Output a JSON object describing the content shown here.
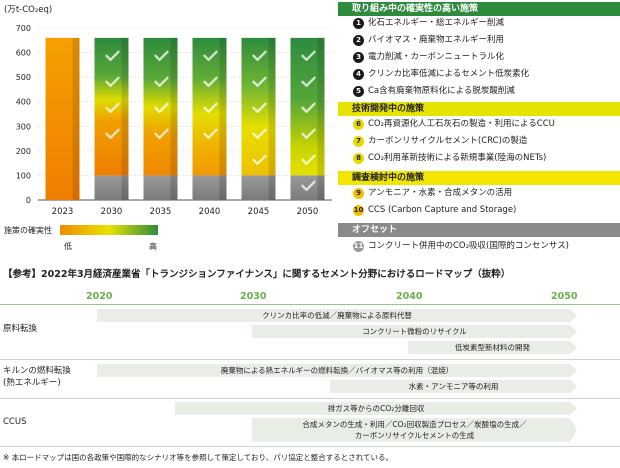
{
  "chart_data": {
    "type": "bar",
    "ylabel": "(万t-CO₂eq)",
    "ylim": [
      0,
      700
    ],
    "yticks": [
      0,
      100,
      200,
      300,
      400,
      500,
      600,
      700
    ],
    "categories": [
      "2023",
      "2030",
      "2035",
      "2040",
      "2045",
      "2050"
    ],
    "values": [
      660,
      660,
      660,
      660,
      660,
      660
    ],
    "offset_values": [
      0,
      100,
      100,
      100,
      100,
      100
    ],
    "check_marks": [
      0,
      4,
      4,
      4,
      5,
      6
    ],
    "legend": {
      "title": "施策の確実性",
      "low": "低",
      "high": "高"
    },
    "colors": {
      "high": "#2e8b3e",
      "mid": "#e6e300",
      "low": "#f08c00",
      "offset": "#8a8a8a"
    }
  },
  "sections": {
    "high": {
      "title": "取り組み中の確実性の高い施策",
      "items": [
        {
          "n": "1",
          "text": "化石エネルギー・総エネルギー削減"
        },
        {
          "n": "2",
          "text": "バイオマス・廃棄物エネルギー利用"
        },
        {
          "n": "3",
          "text": "電力削減・カーボンニュートラル化"
        },
        {
          "n": "4",
          "text": "クリンカ比率低減によるセメント低炭素化"
        },
        {
          "n": "5",
          "text": "Ca含有廃棄物原料化による脱炭酸削減"
        }
      ]
    },
    "dev": {
      "title": "技術開発中の施策",
      "items": [
        {
          "n": "6",
          "text": "CO₂再資源化人工石灰石の製造・利用によるCCU"
        },
        {
          "n": "7",
          "text": "カーボンリサイクルセメント(CRC)の製造"
        },
        {
          "n": "8",
          "text": "CO₂利用革新技術による新規事業(陸海のNETs)"
        }
      ]
    },
    "study": {
      "title": "調査検討中の施策",
      "items": [
        {
          "n": "9",
          "text": "アンモニア・水素・合成メタンの活用"
        },
        {
          "n": "10",
          "text": "CCS (Carbon Capture and Storage)"
        }
      ]
    },
    "offset": {
      "title": "オフセット",
      "items": [
        {
          "n": "11",
          "text": "コンクリート併用中のCO₂吸収(国際的コンセンサス)"
        }
      ]
    }
  },
  "roadmap": {
    "title": "【参考】2022年3月経済産業省「トランジションファイナンス」に関するセメント分野におけるロードマップ（抜粋）",
    "years": [
      "2020",
      "2030",
      "2040",
      "2050"
    ],
    "categories": [
      {
        "name": "原料転換"
      },
      {
        "name": "キルンの燃料転換\n(熱エネルギー)"
      },
      {
        "name": "CCUS"
      }
    ],
    "arrows": [
      "クリンカ比率の低減／廃棄物による原料代替",
      "コンクリート微粉のリサイクル",
      "低炭素型新材料の開発",
      "廃棄物による熱エネルギーの燃料転換／バイオマス等の利用（混焼）",
      "水素・アンモニア等の利用",
      "排ガス等からのCO₂分離回収",
      "合成メタンの生成・利用／CO₂回収製造プロセス／炭酸塩の生成／",
      "カーボンリサイクルセメントの生成"
    ],
    "footnote": "※ 本ロードマップは国の各政策や国際的なシナリオ等を参照して策定しており、パリ協定と整合するとされている。"
  }
}
